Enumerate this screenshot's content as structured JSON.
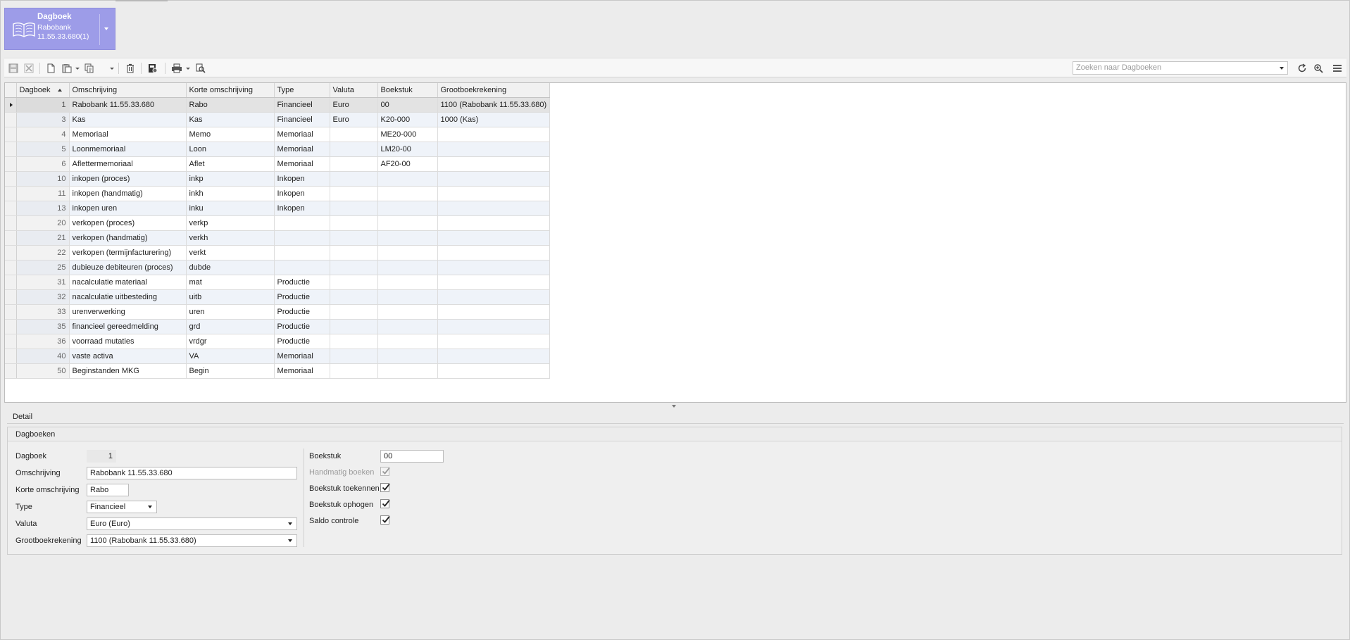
{
  "header": {
    "title": "Dagboek",
    "subtitle_1": "Rabobank",
    "subtitle_2": "11.55.33.680(1)",
    "tile_color": "#9d9ce8",
    "icon": "open-book-icon"
  },
  "toolbar": {
    "search_placeholder": "Zoeken naar Dagboeken",
    "icons": [
      "save-icon",
      "cancel-icon",
      "new-icon",
      "paste-icon",
      "copy-icon",
      "delete-icon",
      "bookmark-icon",
      "print-icon",
      "preview-icon",
      "refresh-icon",
      "zoom-in-icon",
      "hamburger-menu-icon"
    ]
  },
  "grid": {
    "columns": [
      "Dagboek",
      "Omschrijving",
      "Korte omschrijving",
      "Type",
      "Valuta",
      "Boekstuk",
      "Grootboekrekening"
    ],
    "sorted_column": "Dagboek",
    "rows": [
      {
        "dagboek": "1",
        "omschrijving": "Rabobank 11.55.33.680",
        "kort": "Rabo",
        "type": "Financieel",
        "valuta": "Euro",
        "boekstuk": "00",
        "grootboek": "1100 (Rabobank 11.55.33.680)",
        "selected": true
      },
      {
        "dagboek": "3",
        "omschrijving": "Kas",
        "kort": "Kas",
        "type": "Financieel",
        "valuta": "Euro",
        "boekstuk": "K20-000",
        "grootboek": "1000 (Kas)"
      },
      {
        "dagboek": "4",
        "omschrijving": "Memoriaal",
        "kort": "Memo",
        "type": "Memoriaal",
        "valuta": "",
        "boekstuk": "ME20-000",
        "grootboek": ""
      },
      {
        "dagboek": "5",
        "omschrijving": "Loonmemoriaal",
        "kort": "Loon",
        "type": "Memoriaal",
        "valuta": "",
        "boekstuk": "LM20-00",
        "grootboek": ""
      },
      {
        "dagboek": "6",
        "omschrijving": "Aflettermemoriaal",
        "kort": "Aflet",
        "type": "Memoriaal",
        "valuta": "",
        "boekstuk": "AF20-00",
        "grootboek": ""
      },
      {
        "dagboek": "10",
        "omschrijving": "inkopen (proces)",
        "kort": "inkp",
        "type": "Inkopen",
        "valuta": "",
        "boekstuk": "",
        "grootboek": ""
      },
      {
        "dagboek": "11",
        "omschrijving": "inkopen (handmatig)",
        "kort": "inkh",
        "type": "Inkopen",
        "valuta": "",
        "boekstuk": "",
        "grootboek": ""
      },
      {
        "dagboek": "13",
        "omschrijving": "inkopen uren",
        "kort": "inku",
        "type": "Inkopen",
        "valuta": "",
        "boekstuk": "",
        "grootboek": ""
      },
      {
        "dagboek": "20",
        "omschrijving": "verkopen (proces)",
        "kort": "verkp",
        "type": "",
        "valuta": "",
        "boekstuk": "",
        "grootboek": ""
      },
      {
        "dagboek": "21",
        "omschrijving": "verkopen (handmatig)",
        "kort": "verkh",
        "type": "",
        "valuta": "",
        "boekstuk": "",
        "grootboek": ""
      },
      {
        "dagboek": "22",
        "omschrijving": "verkopen (termijnfacturering)",
        "kort": "verkt",
        "type": "",
        "valuta": "",
        "boekstuk": "",
        "grootboek": ""
      },
      {
        "dagboek": "25",
        "omschrijving": "dubieuze debiteuren (proces)",
        "kort": "dubde",
        "type": "",
        "valuta": "",
        "boekstuk": "",
        "grootboek": ""
      },
      {
        "dagboek": "31",
        "omschrijving": "nacalculatie materiaal",
        "kort": "mat",
        "type": "Productie",
        "valuta": "",
        "boekstuk": "",
        "grootboek": ""
      },
      {
        "dagboek": "32",
        "omschrijving": "nacalculatie uitbesteding",
        "kort": "uitb",
        "type": "Productie",
        "valuta": "",
        "boekstuk": "",
        "grootboek": ""
      },
      {
        "dagboek": "33",
        "omschrijving": "urenverwerking",
        "kort": "uren",
        "type": "Productie",
        "valuta": "",
        "boekstuk": "",
        "grootboek": ""
      },
      {
        "dagboek": "35",
        "omschrijving": "financieel gereedmelding",
        "kort": "grd",
        "type": "Productie",
        "valuta": "",
        "boekstuk": "",
        "grootboek": ""
      },
      {
        "dagboek": "36",
        "omschrijving": "voorraad mutaties",
        "kort": "vrdgr",
        "type": "Productie",
        "valuta": "",
        "boekstuk": "",
        "grootboek": ""
      },
      {
        "dagboek": "40",
        "omschrijving": "vaste activa",
        "kort": "VA",
        "type": "Memoriaal",
        "valuta": "",
        "boekstuk": "",
        "grootboek": ""
      },
      {
        "dagboek": "50",
        "omschrijving": "Beginstanden MKG",
        "kort": "Begin",
        "type": "Memoriaal",
        "valuta": "",
        "boekstuk": "",
        "grootboek": ""
      }
    ]
  },
  "detail": {
    "tab_label": "Detail",
    "group_title": "Dagboeken",
    "labels": {
      "dagboek": "Dagboek",
      "omschrijving": "Omschrijving",
      "korte_omschrijving": "Korte omschrijving",
      "type": "Type",
      "valuta": "Valuta",
      "grootboekrekening": "Grootboekrekening",
      "boekstuk": "Boekstuk",
      "handmatig_boeken": "Handmatig boeken",
      "boekstuk_toekennen": "Boekstuk toekennen",
      "boekstuk_ophogen": "Boekstuk ophogen",
      "saldo_controle": "Saldo controle"
    },
    "values": {
      "dagboek": "1",
      "omschrijving": "Rabobank 11.55.33.680",
      "korte_omschrijving": "Rabo",
      "type": "Financieel",
      "valuta": "Euro (Euro)",
      "grootboekrekening": "1100 (Rabobank 11.55.33.680)",
      "boekstuk": "00"
    },
    "checks": {
      "handmatig_boeken": true,
      "boekstuk_toekennen": true,
      "boekstuk_ophogen": true,
      "saldo_controle": true
    }
  }
}
